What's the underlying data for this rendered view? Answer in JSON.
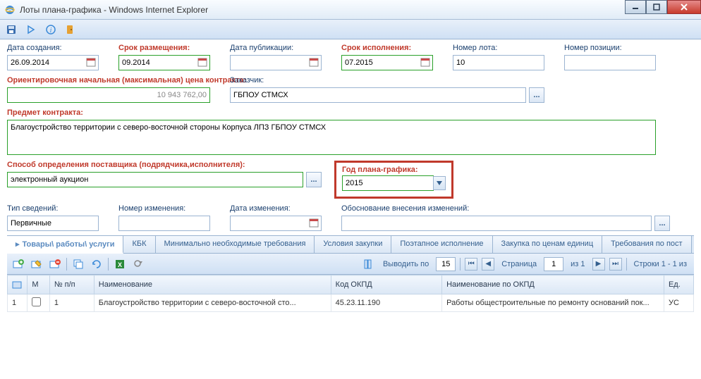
{
  "window": {
    "title": "Лоты плана-графика - Windows Internet Explorer"
  },
  "fields": {
    "creation_date": {
      "label": "Дата создания:",
      "value": "26.09.2014"
    },
    "placement_period": {
      "label": "Срок размещения:",
      "value": "09.2014"
    },
    "publication_date": {
      "label": "Дата публикации:",
      "value": ""
    },
    "execution_period": {
      "label": "Срок исполнения:",
      "value": "07.2015"
    },
    "lot_number": {
      "label": "Номер лота:",
      "value": "10"
    },
    "position_number": {
      "label": "Номер позиции:",
      "value": ""
    },
    "initial_price": {
      "label": "Ориентировочная начальная (максимальная) цена контракта:",
      "value": "10 943 762,00"
    },
    "customer": {
      "label": "Заказчик:",
      "value": "ГБПОУ СТМСХ"
    },
    "contract_subject": {
      "label": "Предмет контракта:",
      "value": "Благоустройство территории с северо-восточной стороны Корпуса ЛПЗ ГБПОУ СТМСХ"
    },
    "supplier_method": {
      "label": "Способ определения поставщика (подрядчика,исполнителя):",
      "value": "электронный аукцион"
    },
    "plan_year": {
      "label": "Год плана-графика:",
      "value": "2015"
    },
    "info_type": {
      "label": "Тип сведений:",
      "value": "Первичные"
    },
    "change_number": {
      "label": "Номер изменения:",
      "value": ""
    },
    "change_date": {
      "label": "Дата изменения:",
      "value": ""
    },
    "change_justification": {
      "label": "Обоснование внесения изменений:",
      "value": ""
    }
  },
  "tabs": [
    "Товары\\ работы\\ услуги",
    "КБК",
    "Минимально необходимые требования",
    "Условия закупки",
    "Поэтапное исполнение",
    "Закупка по ценам единиц",
    "Требования по пост"
  ],
  "grid_toolbar": {
    "show_by_label": "Выводить по",
    "show_by_value": "15",
    "page_label": "Страница",
    "page_value": "1",
    "page_of": "из 1",
    "rows_label": "Строки 1 - 1 из"
  },
  "grid": {
    "columns": [
      "",
      "М",
      "№ п/п",
      "Наименование",
      "Код ОКПД",
      "Наименование по ОКПД",
      "Ед."
    ],
    "row": {
      "num": "1",
      "npp": "1",
      "name": "Благоустройство территории с северо-восточной сто...",
      "okpd": "45.23.11.190",
      "okpd_name": "Работы общестроительные по ремонту оснований пок...",
      "unit": "УС"
    }
  }
}
